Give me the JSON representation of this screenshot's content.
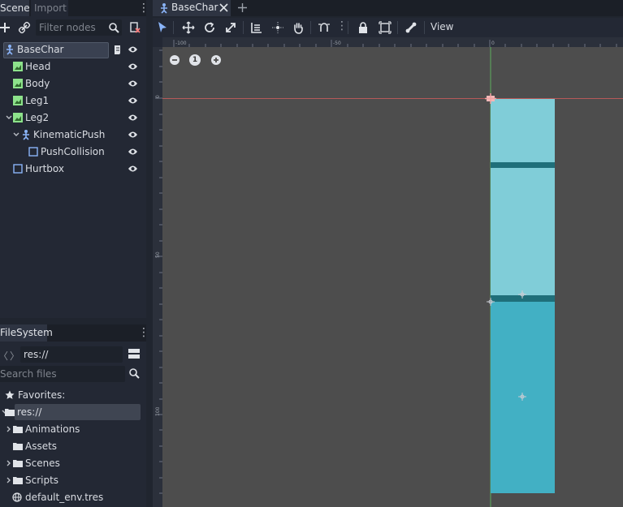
{
  "scene_dock": {
    "tab_scene": "Scene",
    "tab_import": "Import",
    "filter_placeholder": "Filter nodes",
    "tree": [
      {
        "label": "BaseChar",
        "type": "kinematic",
        "selected": true
      },
      {
        "label": "Head",
        "type": "sprite"
      },
      {
        "label": "Body",
        "type": "sprite"
      },
      {
        "label": "Leg1",
        "type": "sprite"
      },
      {
        "label": "Leg2",
        "type": "sprite"
      },
      {
        "label": "KinematicPush",
        "type": "kinematic"
      },
      {
        "label": "PushCollision",
        "type": "collision"
      },
      {
        "label": "Hurtbox",
        "type": "collision"
      }
    ]
  },
  "filesystem": {
    "tab_label": "FileSystem",
    "path": "res://",
    "search_placeholder": "Search files",
    "favorites_label": "Favorites:",
    "root_label": "res://",
    "items": [
      "Animations",
      "Assets",
      "Scenes",
      "Scripts",
      "default_env.tres"
    ]
  },
  "editor": {
    "scene_tab_label": "BaseChar",
    "view_menu": "View",
    "zoom_reset_label": "1",
    "ruler_h_labels": [
      "-100",
      "-50",
      "0"
    ],
    "ruler_v_labels": [
      "0",
      "50",
      "100"
    ]
  },
  "colors": {
    "light_cyan": "#80cdd8",
    "dark_band": "#1f6f7a",
    "mid_cyan": "#42b0c4",
    "axis_red": "#d25d5d",
    "axis_green": "#65d665",
    "icon_blue": "#8ab4f8",
    "icon_green": "#8de28b"
  }
}
